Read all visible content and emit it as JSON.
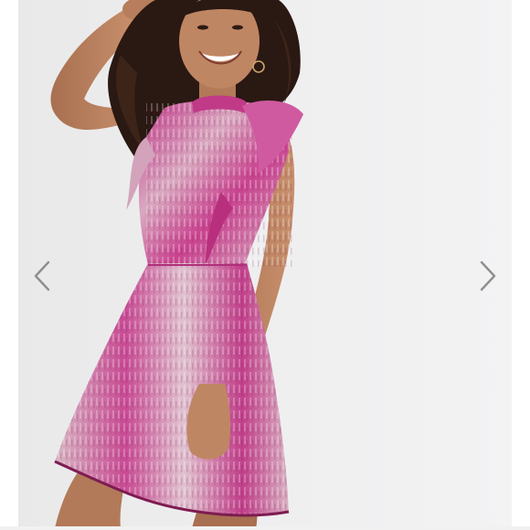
{
  "viewer": {
    "colors": {
      "backdrop": "#ececed",
      "dress_pink": "#c2398a",
      "dress_light": "#d9b3c2",
      "hair": "#2a1812",
      "skin": "#b9805f",
      "arrow": "#8e8e8e"
    },
    "icons": {
      "previous": "chevron-left-icon",
      "next": "chevron-right-icon"
    }
  }
}
